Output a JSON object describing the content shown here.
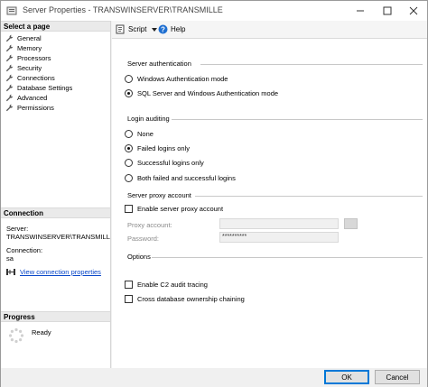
{
  "window": {
    "title": "Server Properties - TRANSWINSERVER\\TRANSMILLE"
  },
  "left": {
    "select_page_header": "Select a page",
    "pages": [
      {
        "label": "General"
      },
      {
        "label": "Memory"
      },
      {
        "label": "Processors"
      },
      {
        "label": "Security"
      },
      {
        "label": "Connections"
      },
      {
        "label": "Database Settings"
      },
      {
        "label": "Advanced"
      },
      {
        "label": "Permissions"
      }
    ],
    "connection_header": "Connection",
    "server_label": "Server:",
    "server_value": "TRANSWINSERVER\\TRANSMILLE",
    "connection_label": "Connection:",
    "connection_value": "sa",
    "view_connection_link": "View connection properties",
    "progress_header": "Progress",
    "progress_status": "Ready"
  },
  "toolbar": {
    "script_label": "Script",
    "help_label": "Help"
  },
  "server_auth": {
    "title": "Server authentication",
    "options": [
      {
        "label": "Windows Authentication mode",
        "checked": false
      },
      {
        "label": "SQL Server and Windows Authentication mode",
        "checked": true
      }
    ]
  },
  "login_auditing": {
    "title": "Login auditing",
    "options": [
      {
        "label": "None",
        "checked": false
      },
      {
        "label": "Failed logins only",
        "checked": true
      },
      {
        "label": "Successful logins only",
        "checked": false
      },
      {
        "label": "Both failed and successful logins",
        "checked": false
      }
    ]
  },
  "proxy": {
    "title": "Server proxy account",
    "enable_label": "Enable server proxy account",
    "account_label": "Proxy account:",
    "account_value": "",
    "password_label": "Password:",
    "password_value": "**********"
  },
  "options": {
    "title": "Options",
    "c2_label": "Enable C2 audit tracing",
    "chaining_label": "Cross database ownership chaining"
  },
  "buttons": {
    "ok": "OK",
    "cancel": "Cancel"
  }
}
